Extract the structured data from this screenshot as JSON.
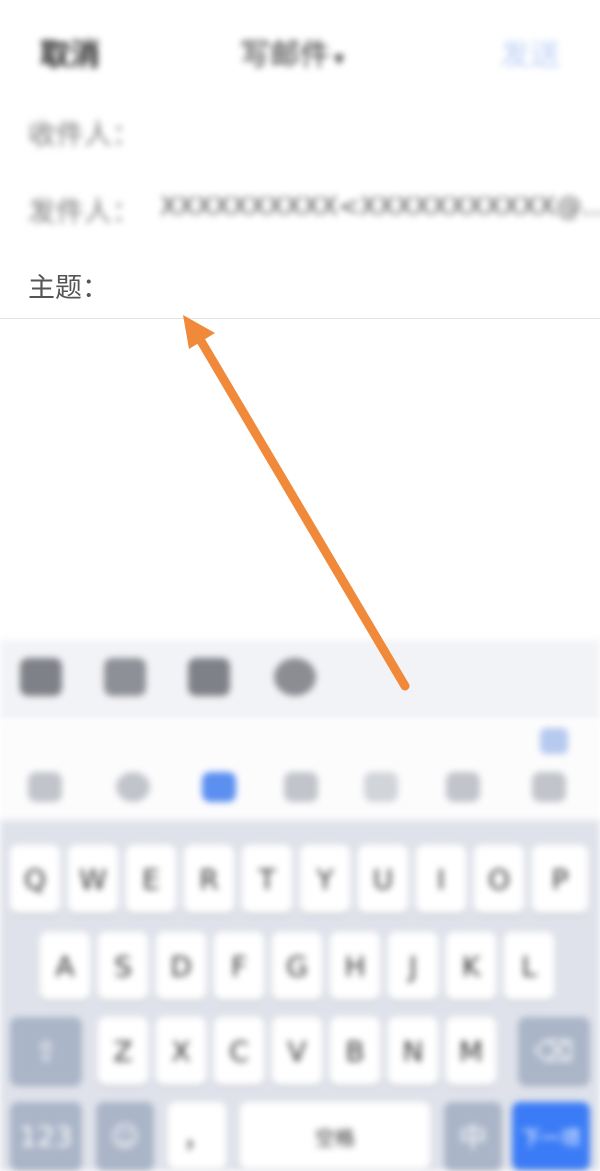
{
  "header": {
    "cancel": "取消",
    "title": "写邮件",
    "title_chevron": "▾",
    "send": "发送"
  },
  "fields": {
    "to_label": "收件人：",
    "from_label": "发件人：",
    "from_value": "XXXXXXXXXX<XXXXXXXXXXX@...",
    "subject_label": "主题："
  },
  "keyboard": {
    "row1": [
      "Q",
      "W",
      "E",
      "R",
      "T",
      "Y",
      "U",
      "I",
      "O",
      "P"
    ],
    "row2": [
      "A",
      "S",
      "D",
      "F",
      "G",
      "H",
      "J",
      "K",
      "L"
    ],
    "row3": [
      "Z",
      "X",
      "C",
      "V",
      "B",
      "N",
      "M"
    ],
    "shift": "⇧",
    "backspace": "⌫",
    "symbols": "123",
    "emoji": "☺",
    "comma": "，",
    "space": "空格",
    "period": "。",
    "globe": "中",
    "enter": "下一项"
  },
  "colors": {
    "accent": "#3b7cf6",
    "arrow": "#f08a3a",
    "keyboard_bg": "#dfe2ea"
  }
}
